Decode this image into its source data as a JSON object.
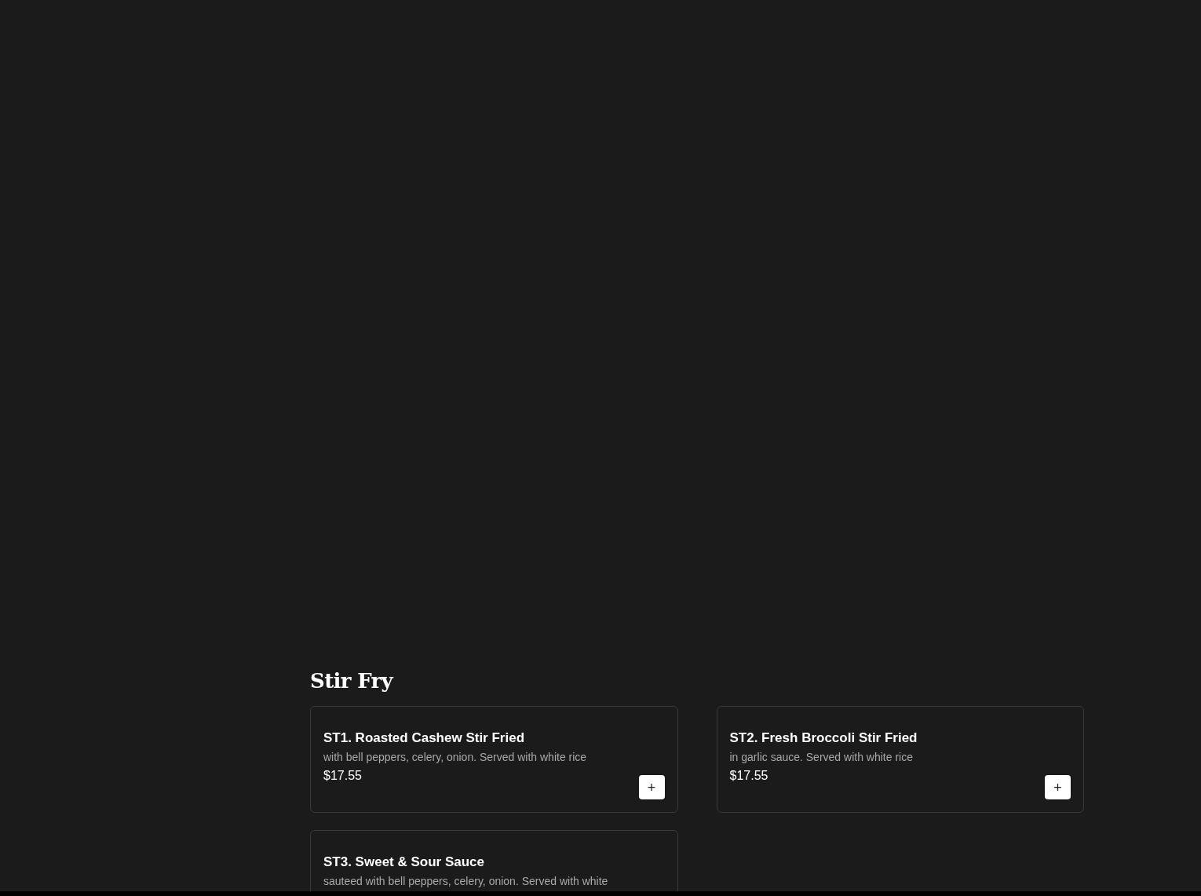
{
  "section": {
    "title": "Stir Fry",
    "items": [
      {
        "name": "ST1. Roasted Cashew Stir Fried",
        "description": "with bell peppers, celery, onion. Served with white rice",
        "price": "$17.55",
        "add_button": "+"
      },
      {
        "name": "ST2. Fresh Broccoli Stir Fried",
        "description": "in garlic sauce. Served with white rice",
        "price": "$17.55",
        "add_button": "+"
      },
      {
        "name": "ST3. Sweet & Sour Sauce",
        "description": "sauteed with bell peppers, celery, onion. Served with white"
      }
    ]
  }
}
